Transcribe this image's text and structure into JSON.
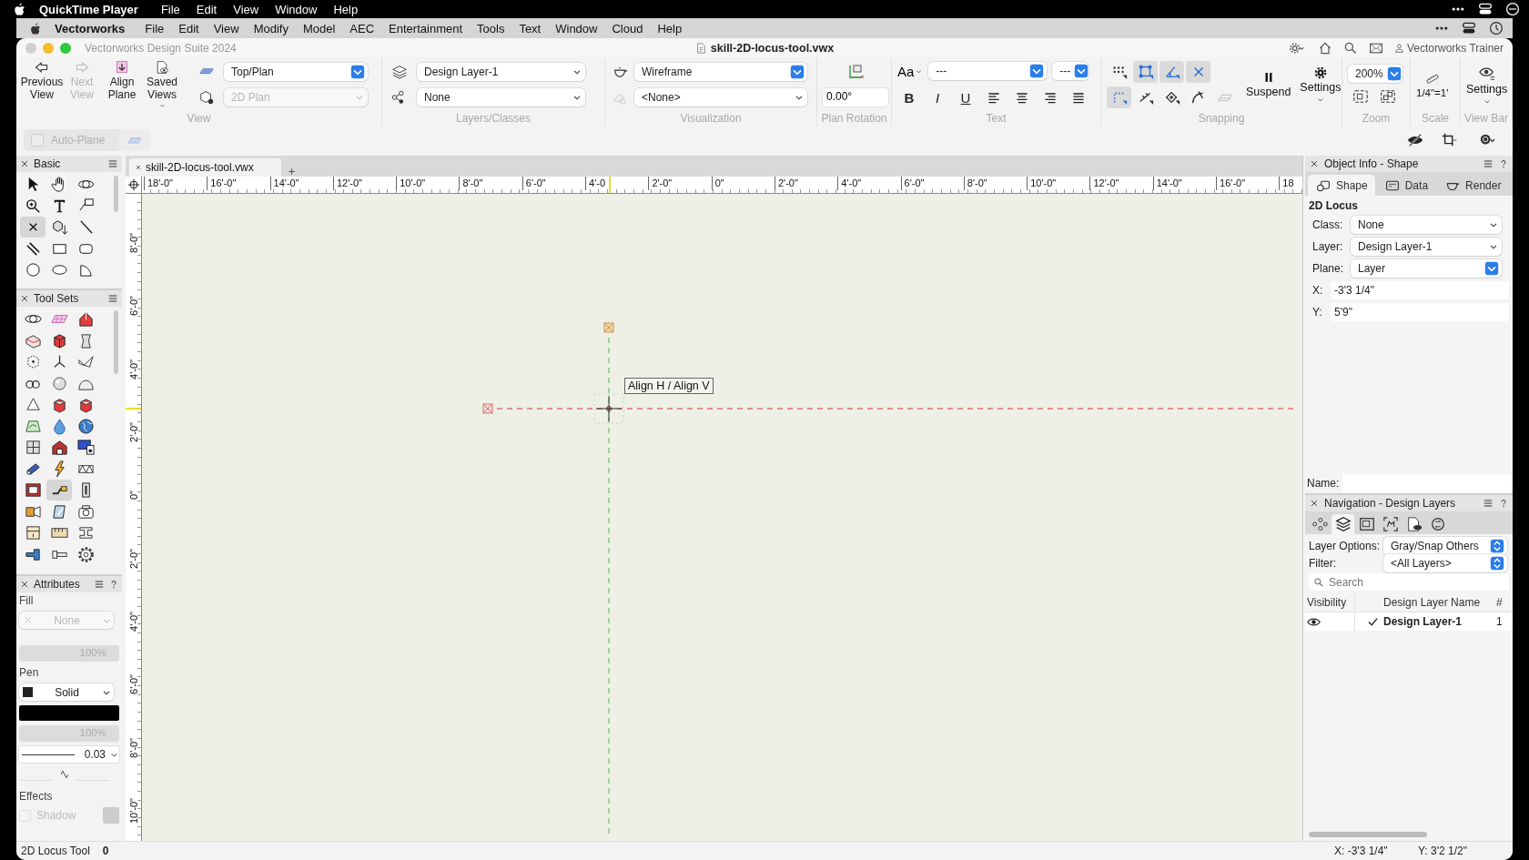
{
  "system_menu": {
    "app": "QuickTime Player",
    "items": [
      "File",
      "Edit",
      "View",
      "Window",
      "Help"
    ]
  },
  "app_menu": {
    "app": "Vectorworks",
    "items": [
      "File",
      "Edit",
      "View",
      "Modify",
      "Model",
      "AEC",
      "Entertainment",
      "Tools",
      "Text",
      "Window",
      "Cloud",
      "Help"
    ]
  },
  "window": {
    "title": "Vectorworks Design Suite 2024",
    "document": "skill-2D-locus-tool.vwx",
    "user": "Vectorworks Trainer"
  },
  "toolbar": {
    "view": {
      "label": "View",
      "buttons": [
        {
          "label": "Previous View",
          "disabled": false
        },
        {
          "label": "Next View",
          "disabled": true
        },
        {
          "label": "Align Plane",
          "disabled": false
        },
        {
          "label": "Saved Views",
          "disabled": false
        }
      ],
      "view_menu": {
        "value": "Top/Plan",
        "disabled": false
      },
      "projection_menu": {
        "value": "2D Plan",
        "disabled": true
      }
    },
    "layers_classes": {
      "label": "Layers/Classes",
      "layer": "Design Layer-1",
      "class": "None"
    },
    "visualization": {
      "label": "Visualization",
      "render_mode": "Wireframe",
      "lighting": "<None>"
    },
    "plan_rotation": {
      "label": "Plan Rotation",
      "value": "0.00°"
    },
    "text": {
      "label": "Text",
      "style_button": "Aa",
      "font": "---",
      "size": "---",
      "styles": [
        "B",
        "I",
        "U"
      ]
    },
    "snapping": {
      "label": "Snapping",
      "toggles": [
        {
          "selected": false
        },
        {
          "selected": true
        },
        {
          "selected": true
        },
        {
          "selected": true
        },
        {
          "selected": true
        },
        {
          "selected": false
        },
        {
          "selected": false
        },
        {
          "selected": false
        },
        {
          "selected": false
        }
      ],
      "suspend": "Suspend",
      "settings": "Settings"
    },
    "zoom": {
      "label": "Zoom",
      "value": "200%"
    },
    "scale": {
      "label": "Scale",
      "value": "1/4\"=1'"
    },
    "view_bar": {
      "label": "View Bar",
      "settings": "Settings"
    },
    "auto_plane": {
      "label": "Auto-Plane",
      "disabled": true
    }
  },
  "palettes": {
    "basic": {
      "title": "Basic",
      "tools": [
        {
          "selected": false
        },
        {
          "selected": false
        },
        {
          "selected": false
        },
        {
          "selected": false
        },
        {
          "selected": false
        },
        {
          "selected": false
        },
        {
          "selected": true
        },
        {
          "selected": false
        },
        {
          "selected": false
        },
        {
          "selected": false
        },
        {
          "selected": false
        },
        {
          "selected": false
        },
        {
          "selected": false
        },
        {
          "selected": false
        },
        {
          "selected": false
        }
      ]
    },
    "tool_sets": {
      "title": "Tool Sets",
      "tools": [
        {
          "selected": false
        },
        {
          "selected": false
        },
        {
          "selected": false
        },
        {
          "selected": false
        },
        {
          "selected": false
        },
        {
          "selected": false
        },
        {
          "selected": false
        },
        {
          "selected": false
        },
        {
          "selected": false
        },
        {
          "selected": false
        },
        {
          "selected": false
        },
        {
          "selected": false
        },
        {
          "selected": false
        },
        {
          "selected": false
        },
        {
          "selected": false
        },
        {
          "selected": false
        },
        {
          "selected": false
        },
        {
          "selected": false
        },
        {
          "selected": false
        },
        {
          "selected": false
        },
        {
          "selected": false
        },
        {
          "selected": false
        },
        {
          "selected": false
        },
        {
          "selected": false
        },
        {
          "selected": false
        },
        {
          "selected": true
        },
        {
          "selected": false
        },
        {
          "selected": false
        },
        {
          "selected": false
        },
        {
          "selected": false
        },
        {
          "selected": false
        },
        {
          "selected": false
        },
        {
          "selected": false
        },
        {
          "selected": false
        },
        {
          "selected": false
        },
        {
          "selected": false
        }
      ]
    },
    "attributes": {
      "title": "Attributes",
      "fill_label": "Fill",
      "fill_style": {
        "value": "None",
        "disabled": true
      },
      "fill_opacity": "100%",
      "pen_label": "Pen",
      "pen_style": "Solid",
      "pen_opacity": "100%",
      "line_weight": "0.03",
      "effects_label": "Effects",
      "shadow": {
        "label": "Shadow",
        "checked": false,
        "disabled": true
      }
    }
  },
  "document_tabs": [
    {
      "label": "skill-2D-locus-tool.vwx",
      "selected": true
    }
  ],
  "rulers": {
    "horizontal": [
      "18'-0\"",
      "16'-0\"",
      "14'-0\"",
      "12'-0\"",
      "10'-0\"",
      "8'-0\"",
      "6'-0\"",
      "4'-0",
      "2'-0\"",
      "0\"",
      "2'-0\"",
      "4'-0\"",
      "6'-0\"",
      "8'-0\"",
      "10'-0\"",
      "12'-0\"",
      "14'-0\"",
      "16'-0\"",
      "18"
    ],
    "vertical": [
      "8'-0\"",
      "6'-0\"",
      "4'-0\"",
      "2'-0\"",
      "0\"",
      "2'-0\"",
      "4'-0\"",
      "6'-0\"",
      "8'-0\"",
      "10'-0\""
    ]
  },
  "canvas": {
    "tooltip": "Align H / Align V"
  },
  "object_info": {
    "title": "Object Info - Shape",
    "tabs": [
      {
        "label": "Shape",
        "selected": true
      },
      {
        "label": "Data",
        "selected": false
      },
      {
        "label": "Render",
        "selected": false
      }
    ],
    "object_type": "2D Locus",
    "fields": [
      {
        "label": "Class:",
        "value": "None",
        "kind": "menu"
      },
      {
        "label": "Layer:",
        "value": "Design Layer-1",
        "kind": "menu"
      },
      {
        "label": "Plane:",
        "value": "Layer",
        "kind": "popup"
      },
      {
        "label": "X:",
        "value": "-3'3 1/4\"",
        "kind": "text"
      },
      {
        "label": "Y:",
        "value": "5'9\"",
        "kind": "text"
      }
    ],
    "name_label": "Name:"
  },
  "navigation": {
    "title": "Navigation - Design Layers",
    "tabs": [
      {
        "selected": false
      },
      {
        "selected": true
      },
      {
        "selected": false
      },
      {
        "selected": false
      },
      {
        "selected": false
      },
      {
        "selected": false
      }
    ],
    "layer_options": {
      "label": "Layer Options:",
      "value": "Gray/Snap Others"
    },
    "filter": {
      "label": "Filter:",
      "value": "<All Layers>"
    },
    "search": {
      "placeholder": "Search"
    },
    "columns": [
      "Visibility",
      "Design Layer Name",
      "#"
    ],
    "layers": [
      {
        "name": "Design Layer-1",
        "number": "1",
        "visible": true,
        "active": true
      }
    ]
  },
  "status_bar": {
    "tool": "2D Locus Tool",
    "count": "0",
    "x": "X: -3'3 1/4\"",
    "y": "Y: 3'2 1/2\""
  }
}
